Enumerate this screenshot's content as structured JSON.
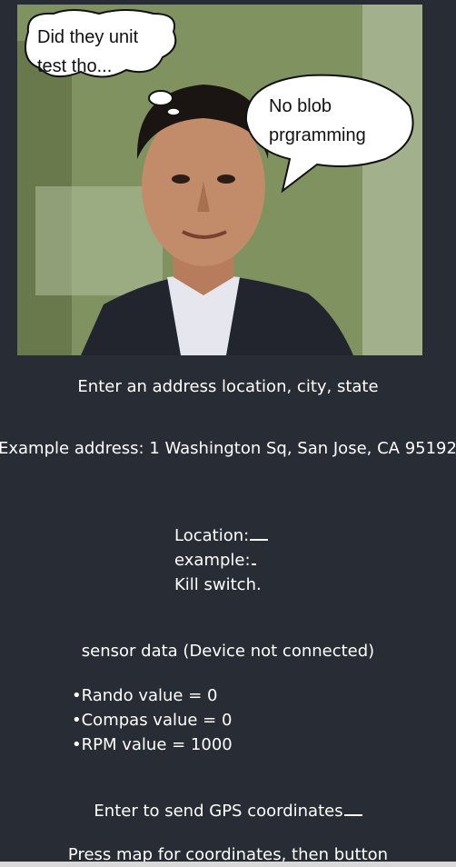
{
  "meme": {
    "bubble_left": [
      "Did they unit",
      "test tho..."
    ],
    "bubble_right": [
      "No blob",
      "prgramming"
    ]
  },
  "instructions": {
    "address_prompt": "Enter an address location, city, state",
    "example_address": "Example address: 1 Washington Sq, San Jose, CA 95192"
  },
  "status": {
    "location_label": "Location:",
    "example_label": "example:",
    "kill_switch_label": "Kill switch."
  },
  "sensor": {
    "title": "sensor data (Device not connected)",
    "items": [
      "•Rando value = 0",
      "•Compas value = 0",
      "•RPM value = 1000"
    ]
  },
  "gps": {
    "send_label": "Enter to send GPS coordinates",
    "map_hint": "Press map for coordinates, then button"
  }
}
